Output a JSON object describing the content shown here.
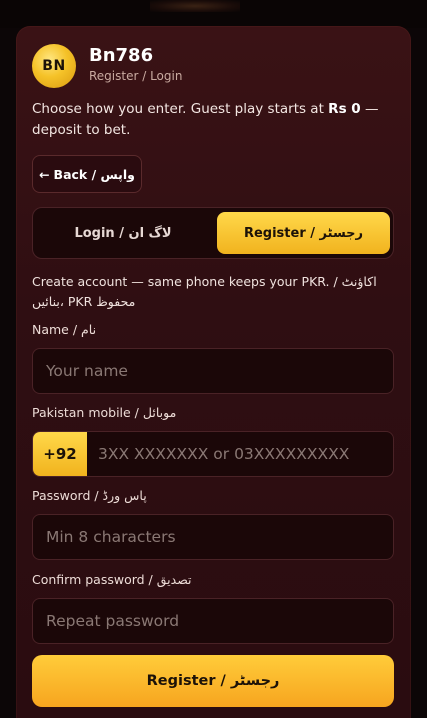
{
  "brand": {
    "logo_text": "BN",
    "name": "Bn786",
    "subtitle": "Register / Login"
  },
  "intro": {
    "text_before": "Choose how you enter. Guest play starts at ",
    "amount": "Rs 0",
    "text_after": " — deposit to bet."
  },
  "back_button": {
    "arrow": "←",
    "label": "Back / واپس"
  },
  "tabs": [
    {
      "label": "Login / لاگ ان",
      "active": false
    },
    {
      "label": "Register / رجسٹر",
      "active": true
    }
  ],
  "hint": "Create account — same phone keeps your PKR. / اکاؤنٹ بنائیں، PKR محفوظ",
  "form": {
    "name": {
      "label": "Name / نام",
      "placeholder": "Your name",
      "value": ""
    },
    "mobile": {
      "label": "Pakistan mobile / موبائل",
      "prefix": "+92",
      "placeholder": "3XX XXXXXXX or 03XXXXXXXXX",
      "value": ""
    },
    "password": {
      "label": "Password / پاس ورڈ",
      "placeholder": "Min 8 characters",
      "value": ""
    },
    "confirm_password": {
      "label": "Confirm password / تصدیق",
      "placeholder": "Repeat password",
      "value": ""
    }
  },
  "submit_label": "Register / رجسٹر",
  "colors": {
    "accent": "#f5be24",
    "background": "#2f0e12",
    "field_bg": "#1b0708",
    "border": "#4a2226"
  }
}
